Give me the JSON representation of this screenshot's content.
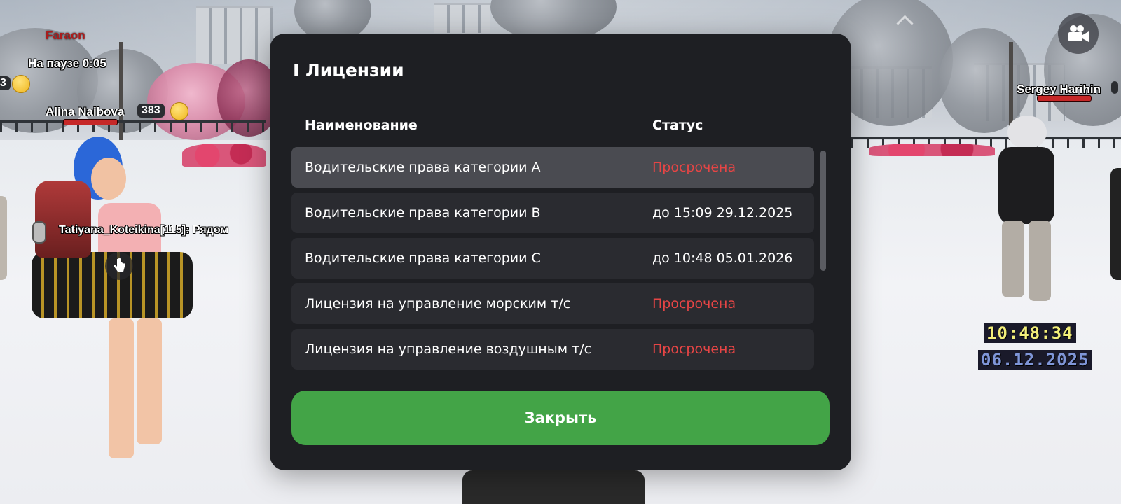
{
  "hud": {
    "nicknames": {
      "faraon": "Faraon",
      "paused": "На паузе 0:05",
      "partial_level": "3",
      "alina": "Alina Naibova",
      "alina_level": "383",
      "sergey": "Sergey Harihin",
      "tatiyana_chat": "Tatiyana_Koteikina[115]: Рядом"
    },
    "clock": {
      "time": "10:48:34",
      "date": "06.12.2025"
    },
    "icons": {
      "camera": "video-camera-icon",
      "interact": "hand-pointer-icon",
      "expand": "chevron-up-icon",
      "emoji": "sleepy-face-emoji-icon"
    }
  },
  "modal": {
    "title": "I Лицензии",
    "columns": {
      "name": "Наименование",
      "status": "Статус"
    },
    "rows": [
      {
        "name": "Водительские права категории A",
        "status": "Просрочена",
        "expired": true,
        "selected": true
      },
      {
        "name": "Водительские права категории B",
        "status": "до 15:09 29.12.2025",
        "expired": false,
        "selected": false
      },
      {
        "name": "Водительские права категории C",
        "status": "до 10:48 05.01.2026",
        "expired": false,
        "selected": false
      },
      {
        "name": "Лицензия на управление морским т/с",
        "status": "Просрочена",
        "expired": true,
        "selected": false
      },
      {
        "name": "Лицензия на управление воздушным т/с",
        "status": "Просрочена",
        "expired": true,
        "selected": false
      }
    ],
    "close_label": "Закрыть"
  },
  "colors": {
    "modal_bg": "#1e1f23",
    "row_bg": "#2a2b30",
    "row_selected_bg": "#4a4b51",
    "expired_text": "#e64545",
    "close_button": "#43a447",
    "clock_time": "#f3ef7a",
    "clock_date": "#7f96d8",
    "nick_red": "#b01a1a"
  }
}
